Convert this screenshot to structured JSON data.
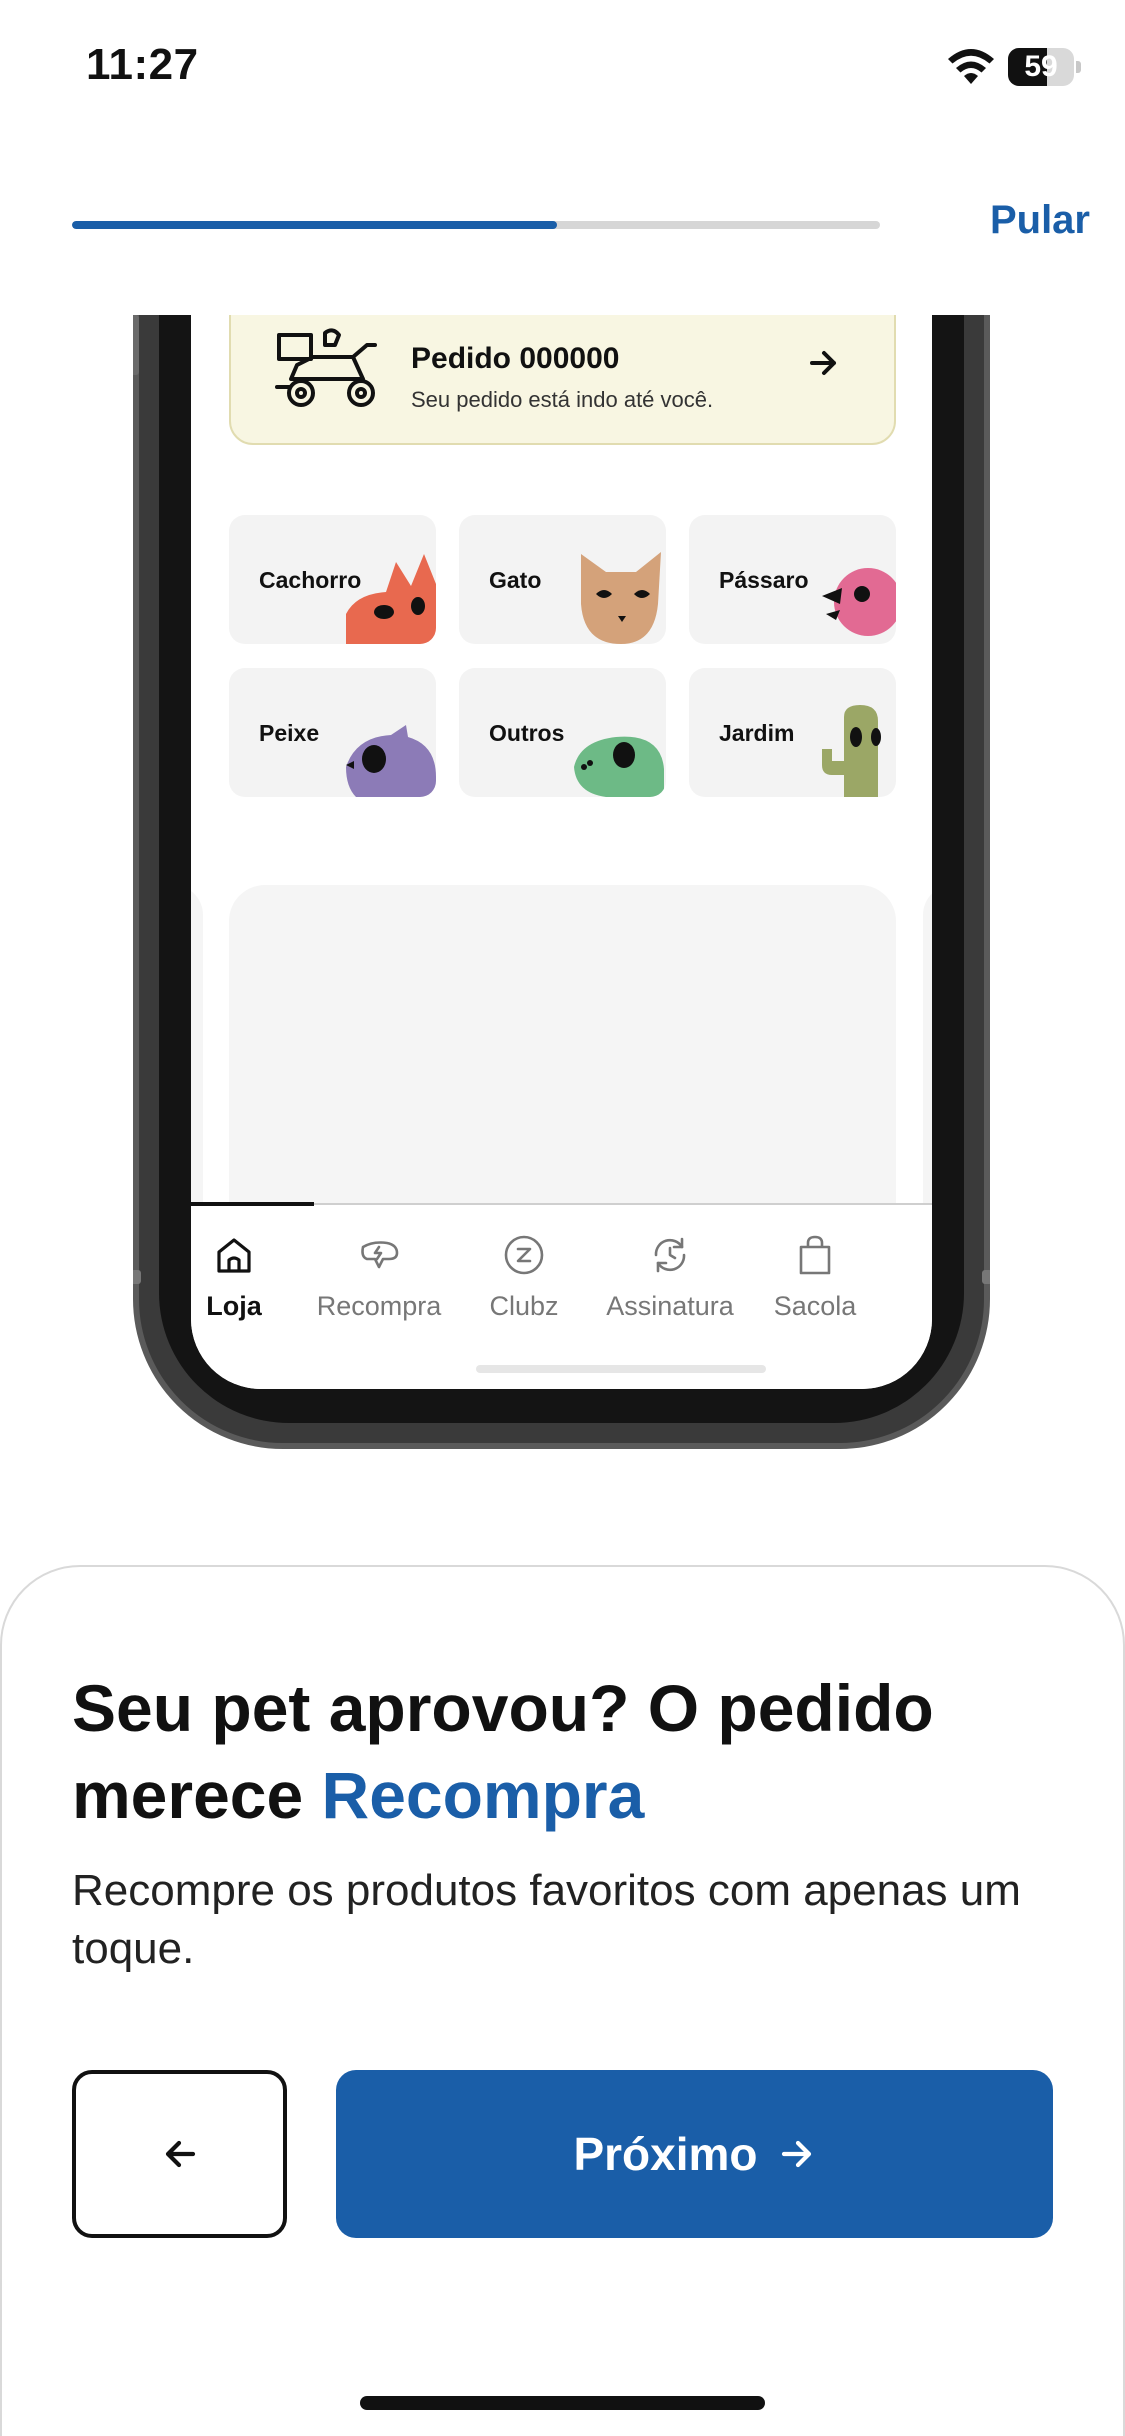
{
  "status_bar": {
    "time": "11:27",
    "battery_level": "59",
    "battery_fraction": 0.59,
    "icons": [
      "wifi-icon",
      "battery-icon"
    ]
  },
  "onboarding": {
    "progress_fraction": 0.6,
    "skip_label": "Pular"
  },
  "mockup": {
    "order": {
      "title": "Pedido 000000",
      "subtitle": "Seu pedido está indo até você.",
      "icons": [
        "delivery-scooter-icon",
        "arrow-right-icon"
      ]
    },
    "categories": [
      {
        "label": "Cachorro",
        "color": "#e8694f"
      },
      {
        "label": "Gato",
        "color": "#d4a27a"
      },
      {
        "label": "Pássaro",
        "color": "#e26a93"
      },
      {
        "label": "Peixe",
        "color": "#8c7bb7"
      },
      {
        "label": "Outros",
        "color": "#6dba86"
      },
      {
        "label": "Jardim",
        "color": "#9ba766"
      }
    ],
    "tabbar": {
      "active": "Loja",
      "items": [
        {
          "label": "Loja",
          "icon": "home-icon"
        },
        {
          "label": "Recompra",
          "icon": "recompra-icon"
        },
        {
          "label": "Clubz",
          "icon": "clubz-icon"
        },
        {
          "label": "Assinatura",
          "icon": "subscription-icon"
        },
        {
          "label": "Sacola",
          "icon": "bag-icon"
        }
      ]
    }
  },
  "sheet": {
    "headline_part1": "Seu pet aprovou? O pedido merece ",
    "headline_accent": "Recompra",
    "description": "Recompre os produtos favoritos com apenas um toque.",
    "next_label": "Próximo",
    "icons": [
      "arrow-left-icon",
      "arrow-right-icon"
    ]
  },
  "colors": {
    "brand_blue": "#1a5ea8",
    "order_card_bg": "#f8f6e2",
    "text_dark": "#111111"
  }
}
